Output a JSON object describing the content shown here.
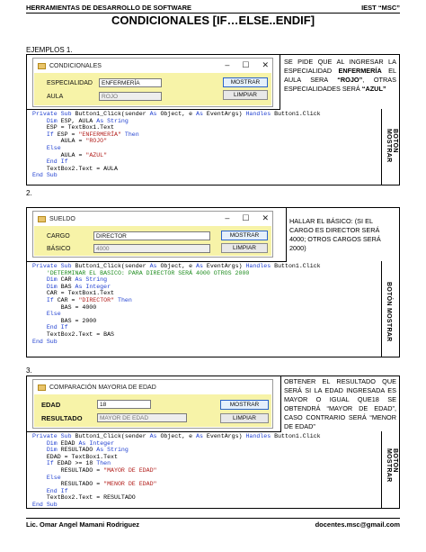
{
  "header": {
    "left": "HERRAMIENTAS DE DESARROLLO DE SOFTWARE",
    "right": "IEST “MSC”"
  },
  "title": "CONDICIONALES [IF…ELSE..ENDIF]",
  "sections": [
    {
      "label": "EJEMPLOS 1.",
      "window": {
        "title": "CONDICIONALES",
        "fields": [
          {
            "label": "ESPECIALIDAD",
            "value": "ENFERMERÍA"
          },
          {
            "label": "AULA",
            "value": "ROJO"
          }
        ],
        "buttons": [
          "MOSTRAR",
          "LIMPIAR"
        ]
      },
      "description_parts": [
        "SE PIDE QUE AL INGRESAR LA ESPECIALIDAD ",
        "ENFERMERÍA",
        " EL AULA SERA ",
        "“ROJO”",
        ", OTRAS ESPECIALIDADES SERÁ ",
        "“AZUL”"
      ],
      "side_label": "BOTÓN MOSTRAR",
      "code": [
        [
          [
            "Private Sub ",
            "kw"
          ],
          [
            "Button1_Click(sender ",
            ""
          ],
          [
            "As ",
            "kw"
          ],
          [
            "Object",
            ""
          ],
          [
            ", e ",
            ""
          ],
          [
            "As ",
            "kw"
          ],
          [
            "EventArgs",
            ""
          ],
          [
            ") ",
            ""
          ],
          [
            "Handles ",
            "kw"
          ],
          [
            "Button1.Click",
            ""
          ]
        ],
        [
          [
            "    ",
            ""
          ],
          [
            "Dim ",
            "kw"
          ],
          [
            "ESP, AULA ",
            ""
          ],
          [
            "As ",
            "kw"
          ],
          [
            "String",
            "kw"
          ]
        ],
        [
          [
            "    ESP = TextBox1.Text",
            ""
          ]
        ],
        [
          [
            "    ",
            ""
          ],
          [
            "If ",
            "kw"
          ],
          [
            "ESP = ",
            ""
          ],
          [
            "\"ENFERMERÍA\"",
            "str"
          ],
          [
            " Then",
            "kw"
          ]
        ],
        [
          [
            "        AULA = ",
            ""
          ],
          [
            "\"ROJO\"",
            "str"
          ]
        ],
        [
          [
            "    ",
            ""
          ],
          [
            "Else",
            "kw"
          ]
        ],
        [
          [
            "        AULA = ",
            ""
          ],
          [
            "\"AZUL\"",
            "str"
          ]
        ],
        [
          [
            "    ",
            ""
          ],
          [
            "End If",
            "kw"
          ]
        ],
        [
          [
            "    TextBox2.Text = AULA",
            ""
          ]
        ],
        [
          [
            "End Sub",
            "kw"
          ]
        ]
      ]
    },
    {
      "label": "2.",
      "window": {
        "title": "SUELDO",
        "fields": [
          {
            "label": "CARGO",
            "value": "DIRECTOR"
          },
          {
            "label": "BÁSICO",
            "value": "4000"
          }
        ],
        "buttons": [
          "MOSTRAR",
          "LIMPIAR"
        ]
      },
      "description_parts": [
        "HALLAR EL BÁSICO: (SI EL CARGO ES DIRECTOR SERÁ 4000; OTROS CARGOS SERÁ 2000)"
      ],
      "side_label": "BOTÓN MOSTRAR",
      "code": [
        [
          [
            "Private Sub ",
            "kw"
          ],
          [
            "Button1_Click(sender ",
            ""
          ],
          [
            "As ",
            "kw"
          ],
          [
            "Object",
            ""
          ],
          [
            ", e ",
            ""
          ],
          [
            "As ",
            "kw"
          ],
          [
            "EventArgs",
            ""
          ],
          [
            ") ",
            ""
          ],
          [
            "Handles ",
            "kw"
          ],
          [
            "Button1.Click",
            ""
          ]
        ],
        [
          [
            "    ",
            ""
          ],
          [
            "'DETERMINAR EL BASICO: PARA DIRECTOR SERÁ 4000 OTROS 2000",
            "cmt"
          ]
        ],
        [
          [
            "    ",
            ""
          ],
          [
            "Dim ",
            "kw"
          ],
          [
            "CAR ",
            ""
          ],
          [
            "As ",
            "kw"
          ],
          [
            "String",
            "kw"
          ]
        ],
        [
          [
            "    ",
            ""
          ],
          [
            "Dim ",
            "kw"
          ],
          [
            "BAS ",
            ""
          ],
          [
            "As ",
            "kw"
          ],
          [
            "Integer",
            "kw"
          ]
        ],
        [
          [
            "    CAR = TextBox1.Text",
            ""
          ]
        ],
        [
          [
            "    ",
            ""
          ],
          [
            "If ",
            "kw"
          ],
          [
            "CAR = ",
            ""
          ],
          [
            "\"DIRECTOR\"",
            "str"
          ],
          [
            " Then",
            "kw"
          ]
        ],
        [
          [
            "        BAS = 4000",
            ""
          ]
        ],
        [
          [
            "    ",
            ""
          ],
          [
            "Else",
            "kw"
          ]
        ],
        [
          [
            "        BAS = 2000",
            ""
          ]
        ],
        [
          [
            "    ",
            ""
          ],
          [
            "End If",
            "kw"
          ]
        ],
        [
          [
            "    TextBox2.Text = BAS",
            ""
          ]
        ],
        [
          [
            "End Sub",
            "kw"
          ]
        ]
      ]
    },
    {
      "label": "3.",
      "window": {
        "title": "COMPARACIÓN MAYORIA DE EDAD",
        "fields": [
          {
            "label": "EDAD",
            "value": "18"
          },
          {
            "label": "RESULTADO",
            "value": "MAYOR DE EDAD"
          }
        ],
        "buttons": [
          "MOSTRAR",
          "LIMPIAR"
        ]
      },
      "description_parts": [
        "OBTENER EL RESULTADO QUE SERÁ SI LA EDAD INGRESADA ES MAYOR O IGUAL QUE18 SE OBTENDRÁ “MAYOR DE EDAD”, CASO CONTRARIO SERÁ “MENOR DE EDAD”"
      ],
      "side_label": "BOTÓN MOSTRAR",
      "code": [
        [
          [
            "Private Sub ",
            "kw"
          ],
          [
            "Button1_Click(sender ",
            ""
          ],
          [
            "As ",
            "kw"
          ],
          [
            "Object",
            ""
          ],
          [
            ", e ",
            ""
          ],
          [
            "As ",
            "kw"
          ],
          [
            "EventArgs",
            ""
          ],
          [
            ") ",
            ""
          ],
          [
            "Handles ",
            "kw"
          ],
          [
            "Button1.Click",
            ""
          ]
        ],
        [
          [
            "    ",
            ""
          ],
          [
            "Dim ",
            "kw"
          ],
          [
            "EDAD ",
            ""
          ],
          [
            "As ",
            "kw"
          ],
          [
            "Integer",
            "kw"
          ]
        ],
        [
          [
            "    ",
            ""
          ],
          [
            "Dim ",
            "kw"
          ],
          [
            "RESULTADO ",
            ""
          ],
          [
            "As ",
            "kw"
          ],
          [
            "String",
            "kw"
          ]
        ],
        [
          [
            "    EDAD = TextBox1.Text",
            ""
          ]
        ],
        [
          [
            "    ",
            ""
          ],
          [
            "If ",
            "kw"
          ],
          [
            "EDAD >= 18 ",
            ""
          ],
          [
            "Then",
            "kw"
          ]
        ],
        [
          [
            "        RESULTADO = ",
            ""
          ],
          [
            "\"MAYOR DE EDAD\"",
            "str"
          ]
        ],
        [
          [
            "    ",
            ""
          ],
          [
            "Else",
            "kw"
          ]
        ],
        [
          [
            "        RESULTADO = ",
            ""
          ],
          [
            "\"MENOR DE EDAD\"",
            "str"
          ]
        ],
        [
          [
            "    ",
            ""
          ],
          [
            "End If",
            "kw"
          ]
        ],
        [
          [
            "    TextBox2.Text = RESULTADO",
            ""
          ]
        ],
        [
          [
            "End Sub",
            "kw"
          ]
        ]
      ]
    }
  ],
  "footer": {
    "left": "Lic. Omar Angel Mamani Rodriguez",
    "right": "docentes.msc@gmail.com"
  },
  "icons": {
    "window_app": "form-icon",
    "minimize": "minimize-icon",
    "maximize": "maximize-icon",
    "close": "close-icon"
  }
}
